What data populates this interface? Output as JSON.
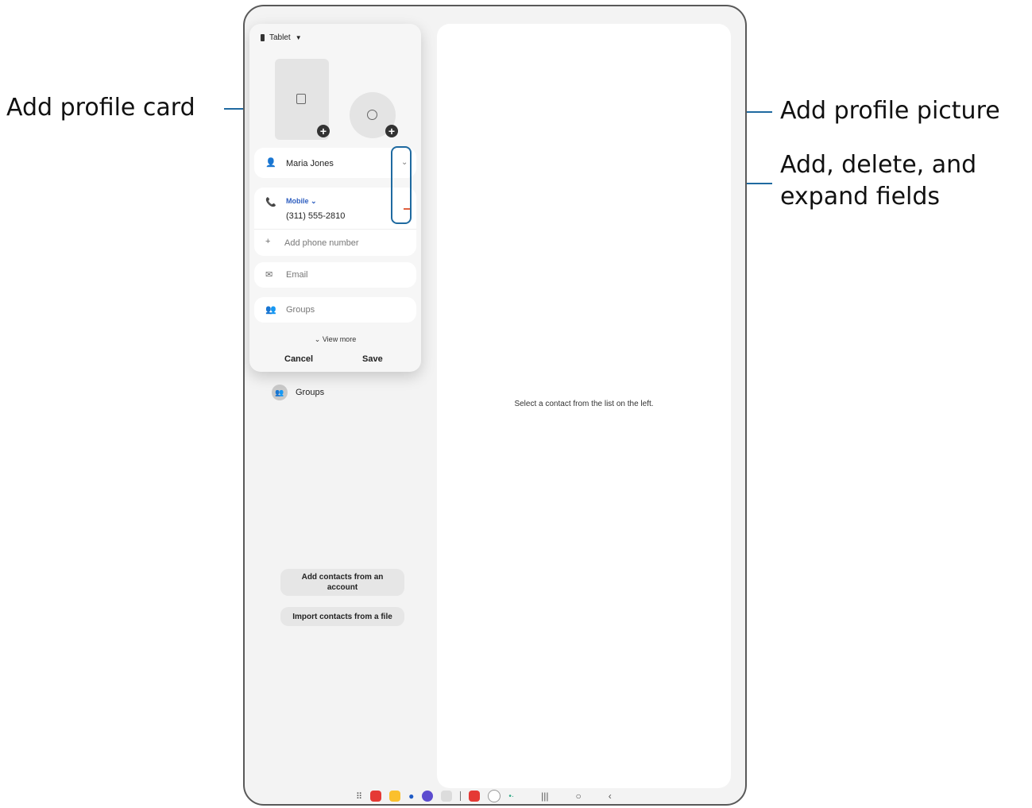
{
  "callouts": {
    "add_profile_card": "Add profile card",
    "add_profile_picture": "Add profile picture",
    "fields_line1": "Add, delete, and",
    "fields_line2": "expand fields"
  },
  "popup": {
    "storage_selector": "Tablet",
    "name_value": "Maria Jones",
    "phone_type": "Mobile",
    "phone_value": "(311) 555-2810",
    "add_phone": "Add phone number",
    "email_placeholder": "Email",
    "groups_placeholder": "Groups",
    "view_more": "View more",
    "cancel": "Cancel",
    "save": "Save"
  },
  "left_pane": {
    "groups": "Groups",
    "add_from_account": "Add contacts from an account",
    "import_from_file": "Import contacts from a file"
  },
  "right_pane": {
    "empty_message": "Select a contact from the list on the left."
  },
  "colors": {
    "callout_line": "#1f6aa0",
    "accent_blue": "#2f5fc0",
    "delete_red": "#e0603f"
  },
  "taskbar_apps": [
    "apps-grid-icon",
    "youtube-music-icon",
    "notes-icon",
    "messages-icon",
    "internet-icon",
    "camera-icon",
    "contacts-icon",
    "clock-icon",
    "recents-icon"
  ]
}
